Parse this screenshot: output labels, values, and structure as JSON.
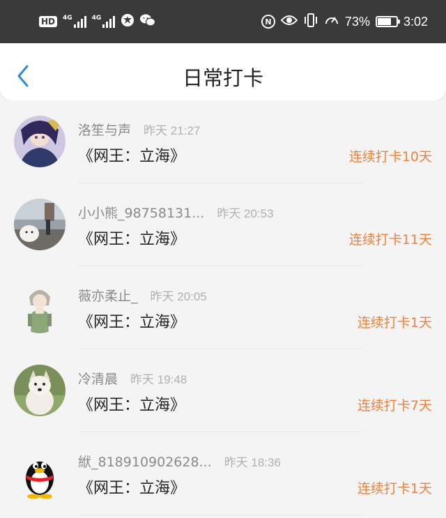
{
  "status_bar": {
    "hd_label": "HD",
    "network1": "4G",
    "network2": "4G",
    "battery_percent": "73%",
    "battery_level": 0.73,
    "time": "3:02",
    "icons": [
      "hd-icon",
      "signal-icon",
      "signal-icon",
      "browser-icon",
      "wechat-icon",
      "nfc-icon",
      "eye-icon",
      "vibrate-icon",
      "speed-icon",
      "battery-icon"
    ]
  },
  "header": {
    "title": "日常打卡",
    "back_icon": "chevron-left-icon",
    "accent": "#2b8be0"
  },
  "colors": {
    "streak": "#f0803a",
    "name": "#8a8a8a",
    "time": "#b0b0b0"
  },
  "checkins": [
    {
      "user": "洛笙与声",
      "time": "昨天 21:27",
      "book": "《网王：立海》",
      "streak": "连续打卡10天",
      "avatar": "anime-avatar"
    },
    {
      "user": "小小熊_98758131...",
      "time": "昨天 20:53",
      "book": "《网王：立海》",
      "streak": "连续打卡11天",
      "avatar": "dog-photo-avatar"
    },
    {
      "user": "薇亦柔止_",
      "time": "昨天 20:05",
      "book": "《网王：立海》",
      "streak": "连续打卡1天",
      "avatar": "anime-boy-avatar"
    },
    {
      "user": "冷清晨",
      "time": "昨天 19:48",
      "book": "《网王：立海》",
      "streak": "连续打卡7天",
      "avatar": "puppy-avatar"
    },
    {
      "user": "絥_818910902628...",
      "time": "昨天 18:36",
      "book": "《网王：立海》",
      "streak": "连续打卡1天",
      "avatar": "penguin-avatar"
    }
  ]
}
